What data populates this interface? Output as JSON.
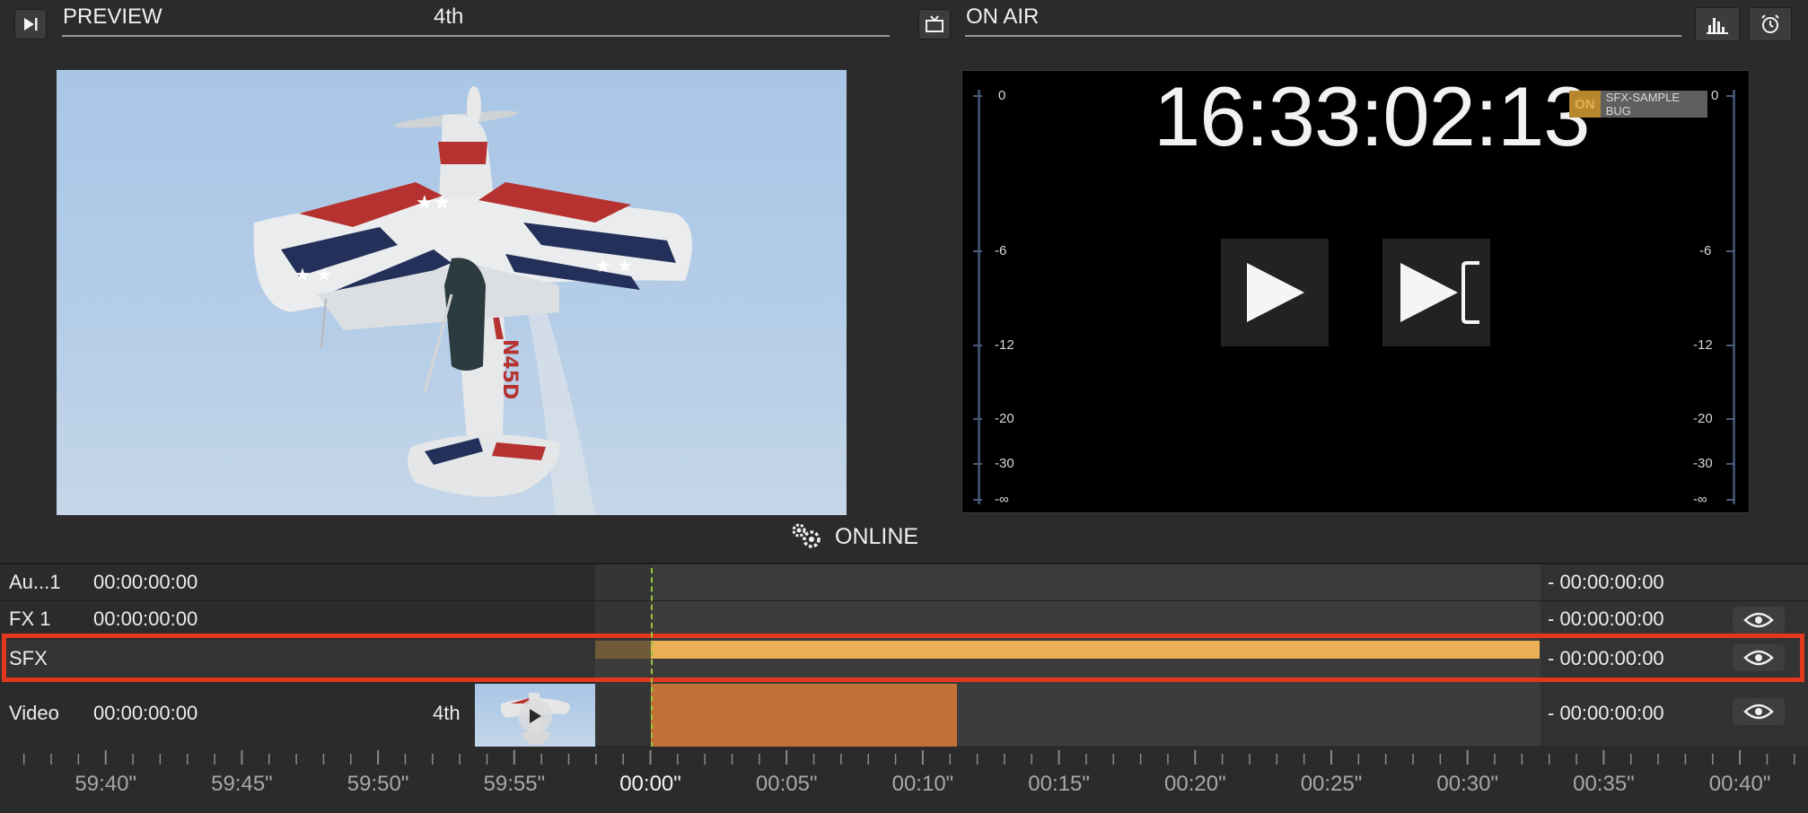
{
  "preview": {
    "title": "PREVIEW",
    "clip_name": "4th",
    "aircraft_label": "N45D"
  },
  "on_air": {
    "title": "ON AIR",
    "clock": "16:33:02:13",
    "bug_on": "ON",
    "bug_label": "SFX-SAMPLE BUG"
  },
  "meters": {
    "left_labels": [
      "0",
      "-6",
      "-12",
      "-20",
      "-30",
      "-∞"
    ],
    "right_labels": [
      "0",
      "-6",
      "-12",
      "-20",
      "-30",
      "-∞"
    ]
  },
  "status": {
    "label": "ONLINE"
  },
  "tracks": [
    {
      "name": "Au...1",
      "time": "00:00:00:00",
      "end_time": "- 00:00:00:00"
    },
    {
      "name": "FX 1",
      "time": "00:00:00:00",
      "end_time": "- 00:00:00:00"
    },
    {
      "name": "SFX",
      "time": "",
      "end_time": "- 00:00:00:00"
    },
    {
      "name": "Video",
      "time": "00:00:00:00",
      "clip_name": "4th",
      "end_time": "- 00:00:00:00"
    }
  ],
  "ruler": [
    "59:40\"",
    "59:45\"",
    "59:50\"",
    "59:55\"",
    "00:00\"",
    "00:05\"",
    "00:10\"",
    "00:15\"",
    "00:20\"",
    "00:25\"",
    "00:30\"",
    "00:35\"",
    "00:40\""
  ],
  "colors": {
    "background": "#2b2b2b",
    "sfx_clip": "#e9b055",
    "sfx_preroll": "#6f5b3a",
    "video_clip": "#c27136",
    "selection": "#e2371f",
    "playhead": "#9bc53d"
  }
}
